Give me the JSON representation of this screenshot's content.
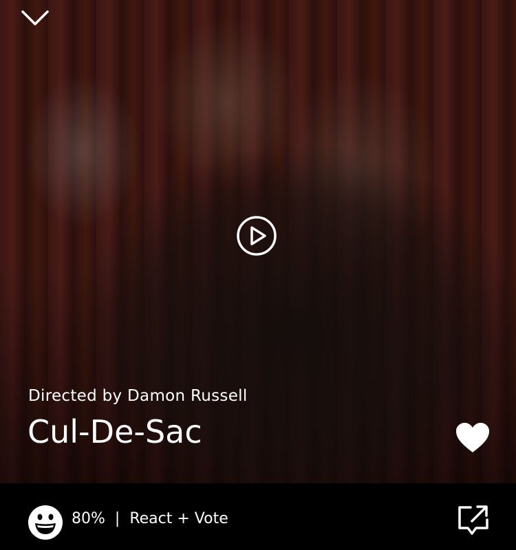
{
  "video": {
    "director_line": "Directed by Damon Russell",
    "title": "Cul-De-Sac"
  },
  "controls": {
    "collapse_icon": "chevron-down-icon",
    "play_icon": "play-circle-icon",
    "favorite_icon": "heart-icon",
    "favorite_active": true
  },
  "reactions": {
    "icon": "smiley-face-icon",
    "score": "80%",
    "separator": "|",
    "action_label": "React + Vote"
  },
  "share": {
    "icon": "share-icon"
  },
  "colors": {
    "bar_background": "#000000",
    "text": "#ffffff",
    "curtain": "#4a1c18"
  }
}
